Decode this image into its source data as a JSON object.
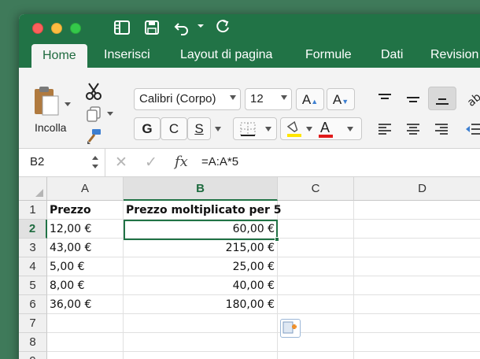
{
  "ribbon": {
    "tabs": [
      "Home",
      "Inserisci",
      "Layout di pagina",
      "Formule",
      "Dati",
      "Revision"
    ],
    "active_tab": "Home",
    "paste_label": "Incolla",
    "font_name": "Calibri (Corpo)",
    "font_size": "12",
    "bold_label": "G",
    "italic_label": "C",
    "underline_label": "S",
    "grow_font_label": "A",
    "shrink_font_label": "A",
    "font_color_label": "A"
  },
  "formula_bar": {
    "cell_ref": "B2",
    "formula": "=A:A*5",
    "fx_label": "fx"
  },
  "sheet": {
    "columns": [
      "A",
      "B",
      "C",
      "D"
    ],
    "selected_column": "B",
    "rows": [
      "1",
      "2",
      "3",
      "4",
      "5",
      "6",
      "7",
      "8",
      "9"
    ],
    "selected_row": "2",
    "headers": {
      "a": "Prezzo",
      "b": "Prezzo moltiplicato per 5"
    },
    "data": [
      {
        "a": "12,00 €",
        "b": "60,00 €"
      },
      {
        "a": "43,00 €",
        "b": "215,00 €"
      },
      {
        "a": "5,00 €",
        "b": "25,00 €"
      },
      {
        "a": "8,00 €",
        "b": "40,00 €"
      },
      {
        "a": "36,00 €",
        "b": "180,00 €"
      }
    ]
  },
  "colors": {
    "accent": "#217346",
    "desktop": "#3f7a5a"
  },
  "icons": {
    "quick_access": [
      "sidebar-icon",
      "save-icon",
      "undo-icon",
      "redo-icon"
    ],
    "paste_option": "paste-options-icon"
  }
}
